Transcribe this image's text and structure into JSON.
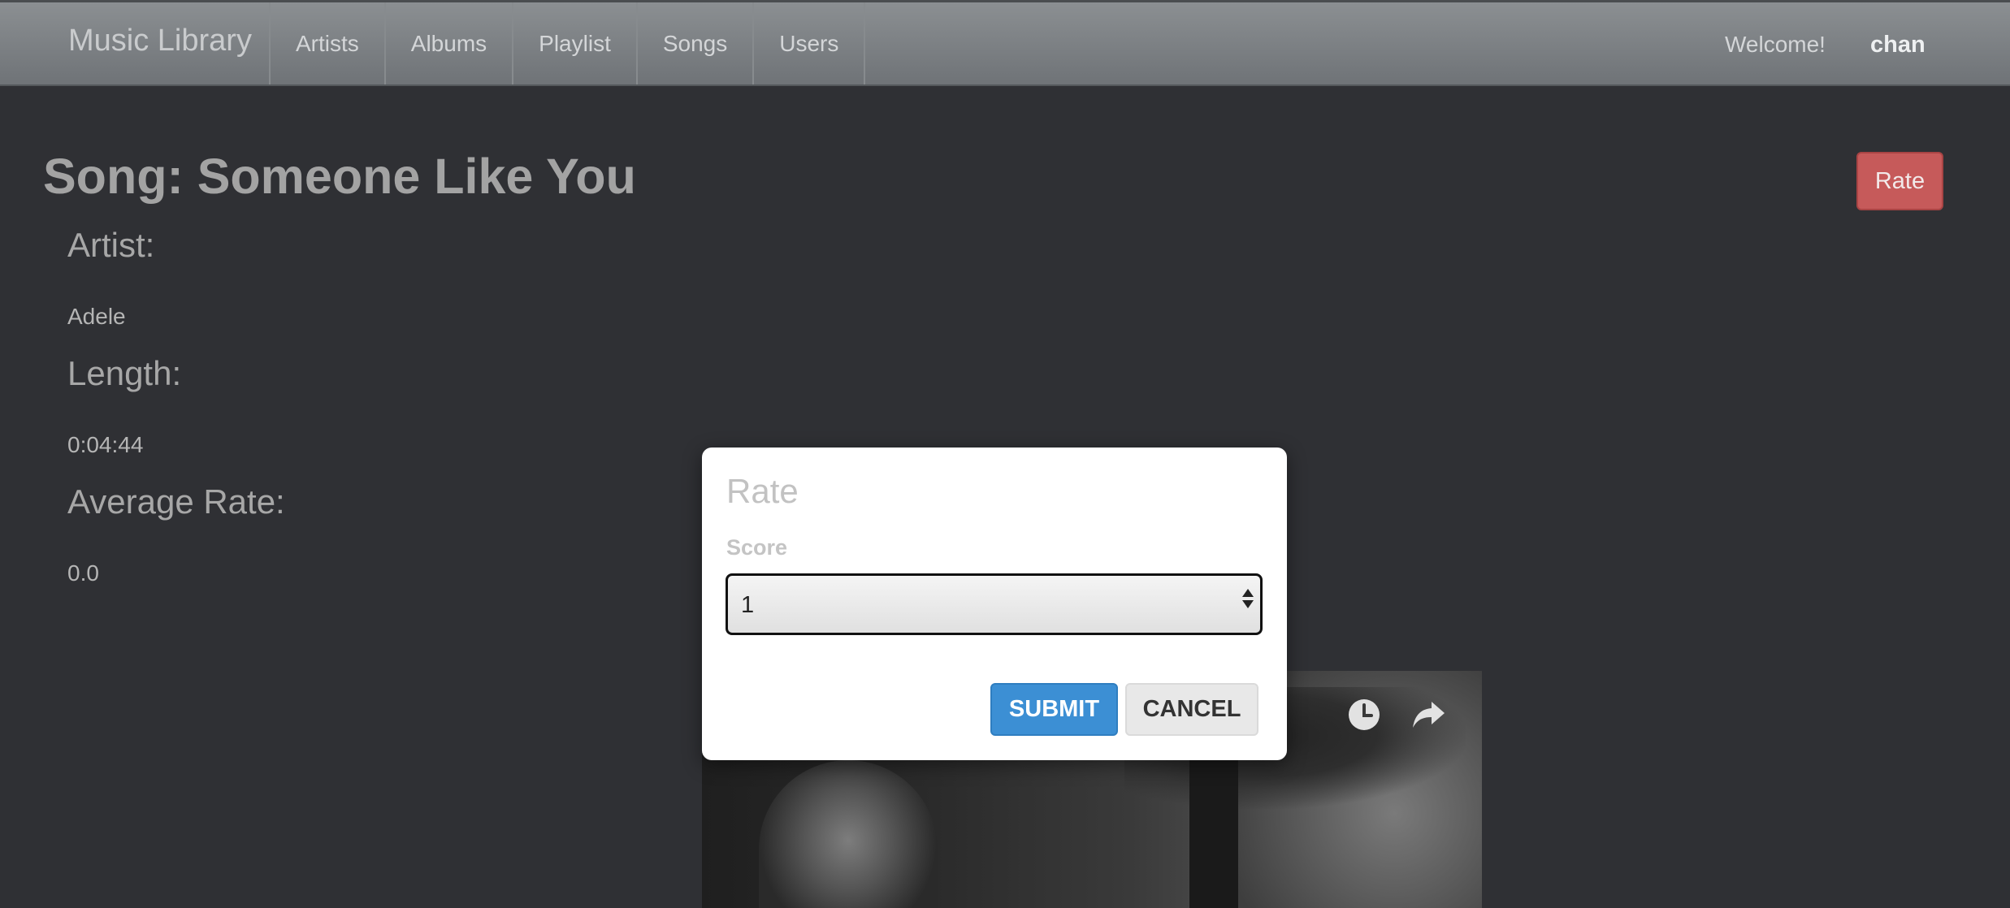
{
  "navbar": {
    "brand": "Music Library",
    "items": [
      {
        "label": "Artists"
      },
      {
        "label": "Albums"
      },
      {
        "label": "Playlist"
      },
      {
        "label": "Songs"
      },
      {
        "label": "Users"
      }
    ],
    "welcome": "Welcome!",
    "username": "chan"
  },
  "song": {
    "title": "Song: Someone Like You",
    "rate_button": "Rate",
    "artist_label": "Artist:",
    "artist_value": "Adele",
    "length_label": "Length:",
    "length_value": "0:04:44",
    "avg_rate_label": "Average Rate:",
    "avg_rate_value": "0.0"
  },
  "video": {
    "icons": [
      "clock-icon",
      "share-icon"
    ]
  },
  "modal": {
    "title": "Rate",
    "score_label": "Score",
    "score_selected": "1",
    "submit_label": "SUBMIT",
    "cancel_label": "CANCEL"
  },
  "colors": {
    "background": "#2f3034",
    "navbar": "#7d8185",
    "rate_button": "#c65a5a",
    "submit_button": "#3c8fd4",
    "cancel_button": "#e8e8e8"
  }
}
